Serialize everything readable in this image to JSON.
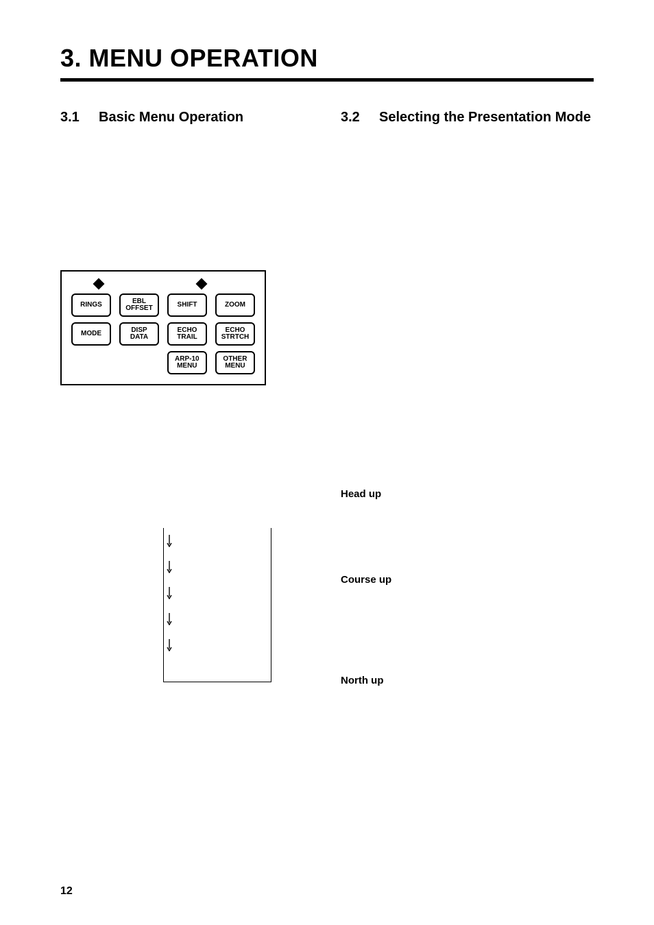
{
  "chapter": {
    "title": "3.  MENU OPERATION"
  },
  "left": {
    "section_num": "3.1",
    "section_title": "Basic Menu Operation",
    "panel": {
      "row1": [
        "RINGS",
        "EBL OFFSET",
        "SHIFT",
        "ZOOM"
      ],
      "row2": [
        "MODE",
        "DISP DATA",
        "ECHO TRAIL",
        "ECHO STRTCH"
      ],
      "row3": [
        "",
        "",
        "ARP-10 MENU",
        "OTHER MENU"
      ]
    }
  },
  "right": {
    "section_num": "3.2",
    "section_title": "Selecting the Presentation Mode",
    "modes": {
      "head_up": "Head up",
      "course_up": "Course up",
      "north_up": "North up"
    }
  },
  "page_number": "12"
}
